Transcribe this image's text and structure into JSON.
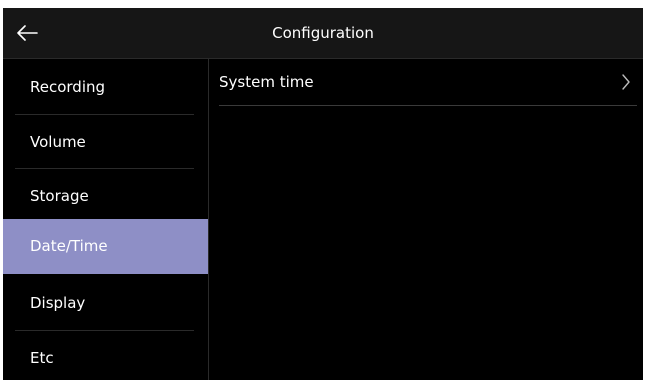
{
  "header": {
    "title": "Configuration",
    "back_icon": "arrow-left-icon"
  },
  "sidebar": {
    "items": [
      {
        "label": "Recording",
        "active": false
      },
      {
        "label": "Volume",
        "active": false
      },
      {
        "label": "Storage",
        "active": false
      },
      {
        "label": "Date/Time",
        "active": true
      },
      {
        "label": "Display",
        "active": false
      },
      {
        "label": "Etc",
        "active": false
      }
    ]
  },
  "content": {
    "rows": [
      {
        "label": "System time",
        "icon": "chevron-right-icon"
      }
    ]
  },
  "colors": {
    "background": "#000000",
    "header": "#161616",
    "active_item": "#8e8fc6",
    "divider": "#2a2a2a",
    "text": "#ffffff"
  }
}
